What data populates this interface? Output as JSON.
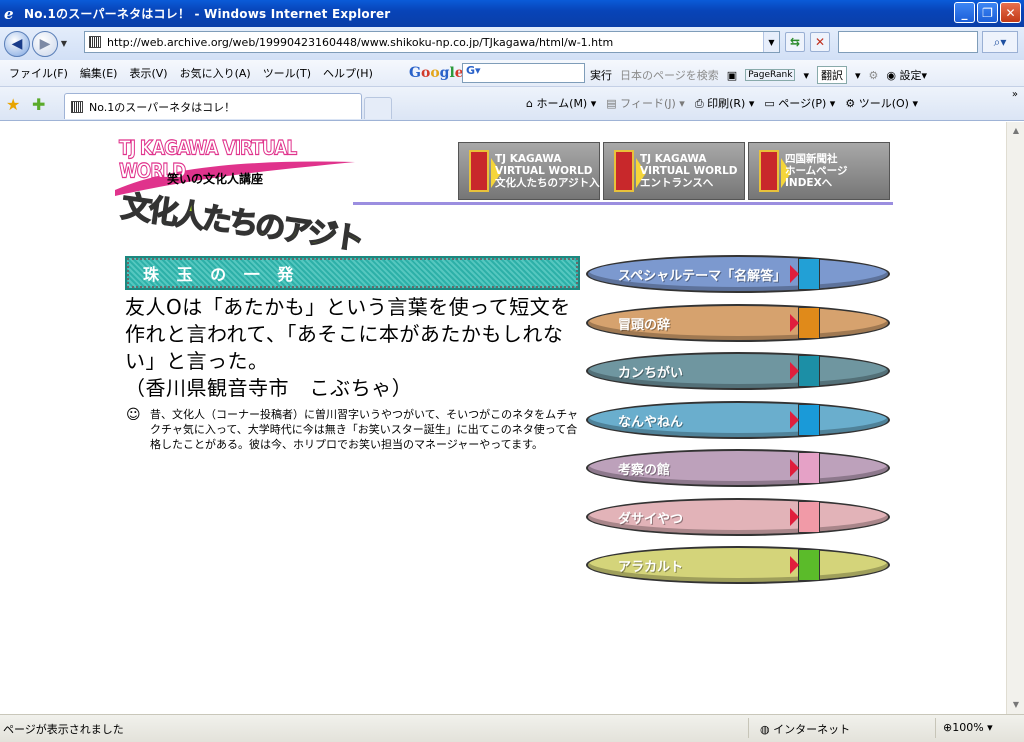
{
  "window": {
    "title": "No.1のスーパーネタはコレ！ - Windows Internet Explorer",
    "controls": [
      "_",
      "❐",
      "✕"
    ]
  },
  "addressbar": {
    "url": "http://web.archive.org/web/19990423160448/www.shikoku-np.co.jp/TJkagawa/html/w-1.htm"
  },
  "menubar": {
    "items": [
      "ファイル(F)",
      "編集(E)",
      "表示(V)",
      "お気に入り(A)",
      "ツール(T)",
      "ヘルプ(H)"
    ],
    "google_label": "Google",
    "google_search_prefix": "G",
    "google_run": "実行",
    "google_translate_page": "日本のページを検索",
    "pagerank": "PageRank",
    "translate": "翻訳",
    "settings": "設定"
  },
  "tabs": {
    "active_tab": "No.1のスーパーネタはコレ！"
  },
  "commandbar": {
    "home": "ホーム(M)",
    "feed": "フィード(J)",
    "print": "印刷(R)",
    "page": "ページ(P)",
    "tools": "ツール(O)"
  },
  "page": {
    "logo": {
      "tj": "TJ KAGAWA VIRTUAL WORLD",
      "subtitle": "笑いの文化人講座",
      "main": "文化人たちのアジト"
    },
    "nav_tiles": [
      {
        "line1": "TJ KAGAWA",
        "line2": "VIRTUAL WORLD",
        "line3": "文化人たちのアジト入口へ"
      },
      {
        "line1": "TJ KAGAWA",
        "line2": "VIRTUAL WORLD",
        "line3": "エントランスへ"
      },
      {
        "line1": "四国新聞社",
        "line2": "ホームページ",
        "line3": "INDEXへ"
      }
    ],
    "section_title": "珠 玉 の 一 発",
    "joke": "友人Oは「あたかも」という言葉を使って短文を作れと言われて、「あそこに本があたかもしれない」と言った。",
    "joke_author": "（香川県観音寺市　こぶちゃ）",
    "comment": "昔、文化人（コーナー投稿者）に曽川習字いうやつがいて、そいつがこのネタをムチャクチャ気に入って、大学時代に今は無き「お笑いスター誕生」に出てこのネタ使って合格したことがある。彼は今、ホリプロでお笑い担当のマネージャーやってます。",
    "menu_buttons": [
      {
        "label": "スペシャルテーマ「名解答」",
        "color": "#7c99cf",
        "door": "#22a0d6"
      },
      {
        "label": "冒頭の辞",
        "color": "#d6a26e",
        "door": "#e08a1a"
      },
      {
        "label": "カンちがい",
        "color": "#6f96a0",
        "door": "#1c8fa6"
      },
      {
        "label": "なんやねん",
        "color": "#6aaecd",
        "door": "#1a9ad8"
      },
      {
        "label": "考察の館",
        "color": "#bda1bb",
        "door": "#e5a1c6"
      },
      {
        "label": "ダサイやつ",
        "color": "#e2b3b8",
        "door": "#f19aa7"
      },
      {
        "label": "アラカルト",
        "color": "#d4d47a",
        "door": "#5bbb2a"
      }
    ]
  },
  "statusbar": {
    "status": "ページが表示されました",
    "zone": "インターネット",
    "zoom": "100%"
  }
}
